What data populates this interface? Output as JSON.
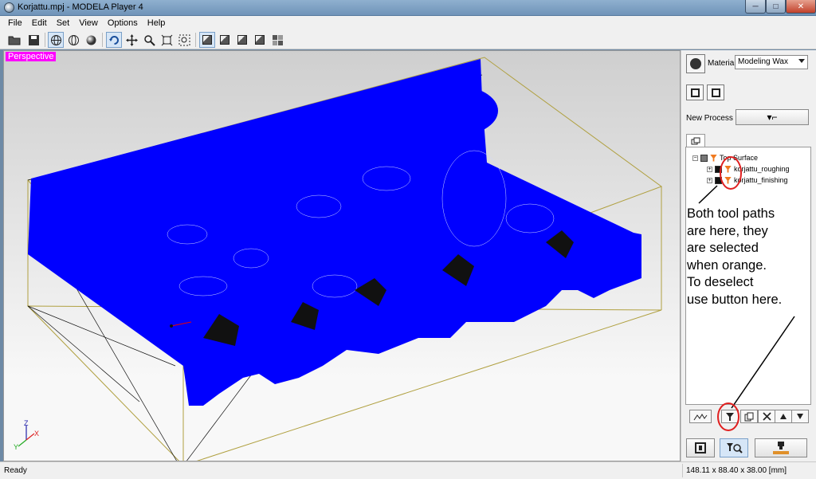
{
  "window": {
    "title": "Korjattu.mpj - MODELA Player 4",
    "min_glyph": "─",
    "max_glyph": "□",
    "close_glyph": "✕"
  },
  "menu": [
    "File",
    "Edit",
    "Set",
    "View",
    "Options",
    "Help"
  ],
  "viewport": {
    "view_label": "Perspective",
    "axis_labels": {
      "x": "X",
      "y": "Y",
      "z": "Z"
    },
    "colors": {
      "model": "#0000ff",
      "bounding_box": "#b0a040",
      "toolpath": "#000000"
    }
  },
  "panel": {
    "material_label": "Material",
    "material_value": "Modeling Wax",
    "new_process_label": "New Process",
    "new_process_glyph": "▾⌐",
    "tree": {
      "root": "Top Surface",
      "children": [
        "korjattu_roughing",
        "korjattu_finishing"
      ]
    },
    "annotation": "Both tool paths\nare here, they\nare selected\nwhen orange.\nTo deselect\nuse button here."
  },
  "status": {
    "left": "Ready",
    "dimensions": "148.11 x 88.40 x 38.00 [mm]"
  }
}
